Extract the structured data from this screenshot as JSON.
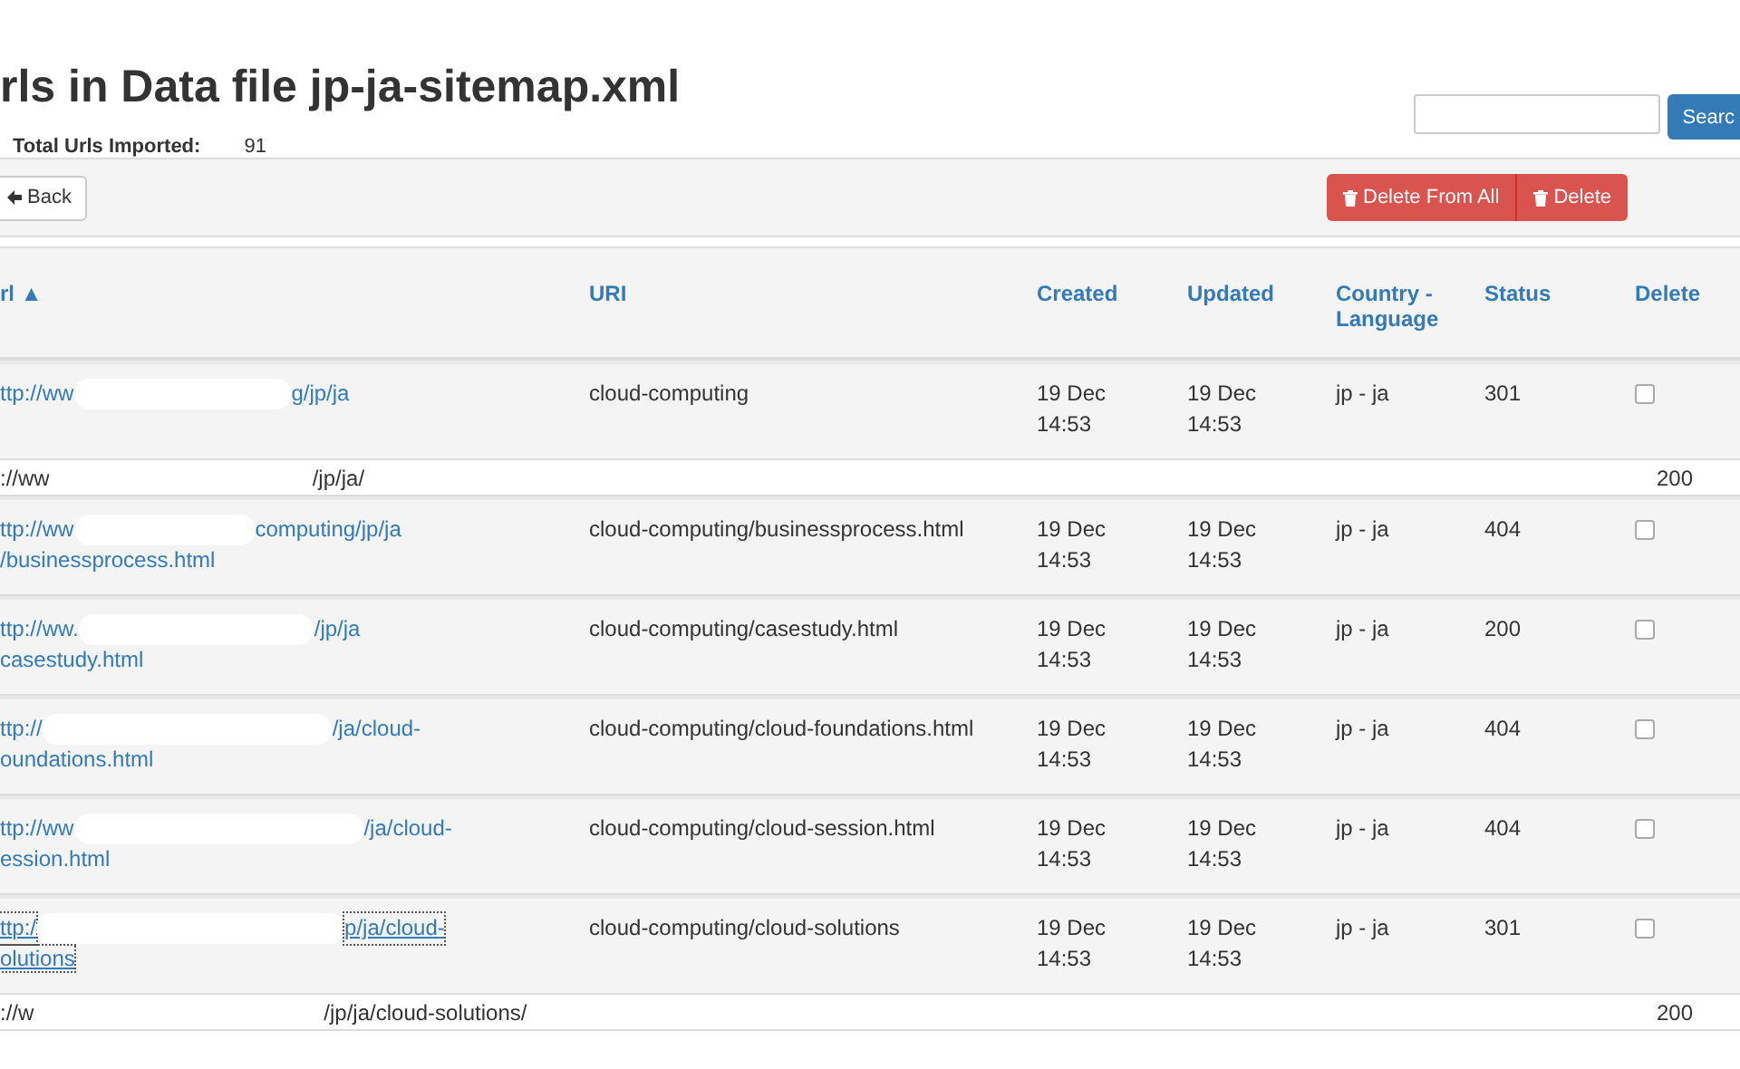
{
  "title": "rls in Data file jp-ja-sitemap.xml",
  "total": {
    "label": "Total Urls Imported:",
    "value": "91"
  },
  "search": {
    "button": "Searc"
  },
  "toolbar": {
    "back": "Back",
    "delete_all": "Delete From All",
    "delete": "Delete"
  },
  "table": {
    "columns": [
      "rl ▲",
      "URI",
      "Created",
      "Updated",
      "Country - Language",
      "Status",
      "Delete"
    ],
    "rows": [
      {
        "url": {
          "start": "ttp://ww",
          "end": "g/jp/ja"
        },
        "uri": "cloud-computing",
        "created": [
          "19 Dec",
          "14:53"
        ],
        "updated": [
          "19 Dec",
          "14:53"
        ],
        "country": "jp - ja",
        "status": "301",
        "checked": false,
        "focused": false,
        "redirect": {
          "start": "://ww",
          "end": "/jp/ja/",
          "status": "200"
        }
      },
      {
        "url": {
          "start": "ttp://ww",
          "end": "computing/jp/ja",
          "line2": "/businessprocess.html"
        },
        "uri": "cloud-computing/businessprocess.html",
        "created": [
          "19 Dec",
          "14:53"
        ],
        "updated": [
          "19 Dec",
          "14:53"
        ],
        "country": "jp - ja",
        "status": "404",
        "checked": false,
        "focused": false
      },
      {
        "url": {
          "start": "ttp://ww.",
          "end": "/jp/ja",
          "line2": "casestudy.html"
        },
        "uri": "cloud-computing/casestudy.html",
        "created": [
          "19 Dec",
          "14:53"
        ],
        "updated": [
          "19 Dec",
          "14:53"
        ],
        "country": "jp - ja",
        "status": "200",
        "checked": false,
        "focused": false
      },
      {
        "url": {
          "start": "ttp://",
          "end": "/ja/cloud-",
          "line2": "oundations.html"
        },
        "uri": "cloud-computing/cloud-foundations.html",
        "created": [
          "19 Dec",
          "14:53"
        ],
        "updated": [
          "19 Dec",
          "14:53"
        ],
        "country": "jp - ja",
        "status": "404",
        "checked": false,
        "focused": false
      },
      {
        "url": {
          "start": "ttp://ww",
          "end": "/ja/cloud-",
          "line2": "ession.html"
        },
        "uri": "cloud-computing/cloud-session.html",
        "created": [
          "19 Dec",
          "14:53"
        ],
        "updated": [
          "19 Dec",
          "14:53"
        ],
        "country": "jp - ja",
        "status": "404",
        "checked": false,
        "focused": false
      },
      {
        "url": {
          "start": "ttp:/",
          "end": "p/ja/cloud-",
          "line2": "olutions"
        },
        "uri": "cloud-computing/cloud-solutions",
        "created": [
          "19 Dec",
          "14:53"
        ],
        "updated": [
          "19 Dec",
          "14:53"
        ],
        "country": "jp - ja",
        "status": "301",
        "checked": false,
        "focused": true,
        "redirect": {
          "start": "://w",
          "end": "/jp/ja/cloud-solutions/",
          "status": "200"
        }
      }
    ]
  }
}
